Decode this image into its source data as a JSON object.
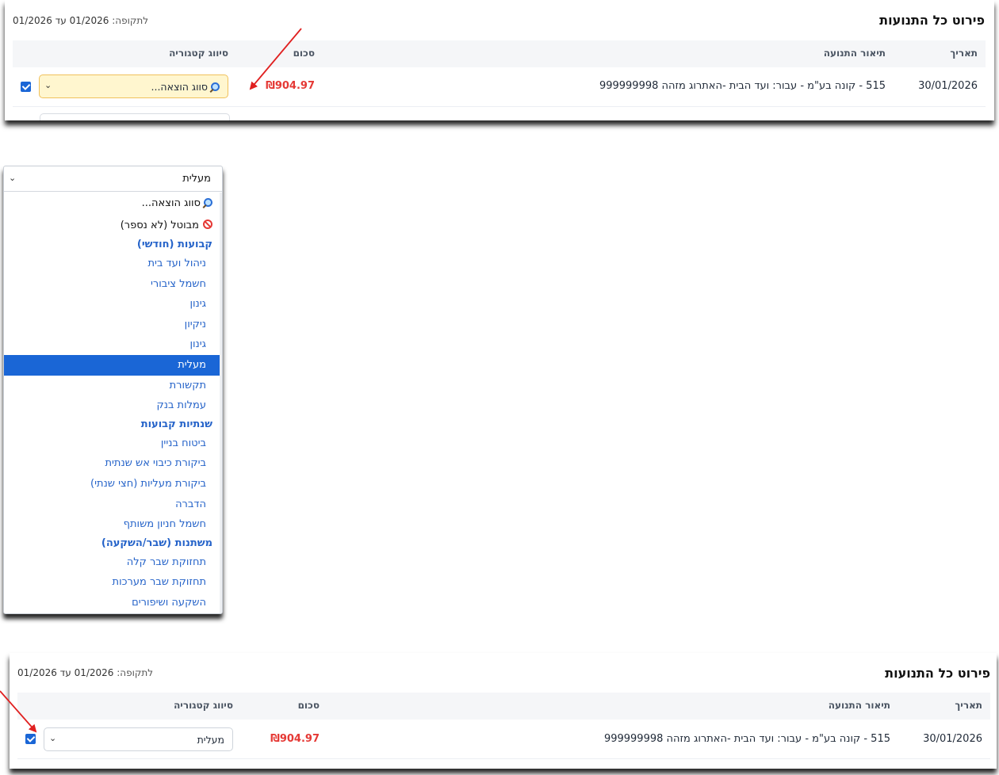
{
  "top_panel": {
    "title": "פירוט כל התנועות",
    "period_label": "לתקופה:",
    "period_range": "01/2026 עד 01/2026",
    "columns": {
      "date": "תאריך",
      "description": "תיאור התנועה",
      "amount": "סכום",
      "category": "סיווג קטגוריה"
    },
    "row": {
      "date": "30/01/2026",
      "description": "515 - קונה בע\"מ - עבור: ועד הבית -האתרוג מזהה 999999998",
      "amount": "₪904.97",
      "category_value": "סווג הוצאה...",
      "checked": true
    }
  },
  "dropdown": {
    "current_value": "מעלית",
    "options": [
      {
        "label": "סווג הוצאה...",
        "kind": "special",
        "icon": "search-icon"
      },
      {
        "label": "מבוטל (לא נספר)",
        "kind": "special",
        "icon": "no-entry-icon"
      },
      {
        "label": "קבועות (חודשי)",
        "kind": "group"
      },
      {
        "label": "ניהול ועד בית",
        "kind": "option"
      },
      {
        "label": "חשמל ציבורי",
        "kind": "option"
      },
      {
        "label": "גינון",
        "kind": "option"
      },
      {
        "label": "ניקיון",
        "kind": "option"
      },
      {
        "label": "גינון",
        "kind": "option"
      },
      {
        "label": "מעלית",
        "kind": "option",
        "selected": true
      },
      {
        "label": "תקשורת",
        "kind": "option"
      },
      {
        "label": "עמלות בנק",
        "kind": "option"
      },
      {
        "label": "שנתיות קבועות",
        "kind": "group"
      },
      {
        "label": "ביטוח בניין",
        "kind": "option"
      },
      {
        "label": "ביקורת כיבוי אש שנתית",
        "kind": "option"
      },
      {
        "label": "ביקורת מעליות (חצי שנתי)",
        "kind": "option"
      },
      {
        "label": "הדברה",
        "kind": "option"
      },
      {
        "label": "חשמל חניון משותף",
        "kind": "option"
      },
      {
        "label": "משתנות (שבר/השקעה)",
        "kind": "group"
      },
      {
        "label": "תחזוקת שבר קלה",
        "kind": "option"
      },
      {
        "label": "תחזוקת שבר מערכות",
        "kind": "option"
      },
      {
        "label": "השקעה ושיפורים",
        "kind": "option"
      }
    ]
  },
  "bottom_panel": {
    "title": "פירוט כל התנועות",
    "period_label": "לתקופה:",
    "period_range": "01/2026 עד 01/2026",
    "columns": {
      "date": "תאריך",
      "description": "תיאור התנועה",
      "amount": "סכום",
      "category": "סיווג קטגוריה"
    },
    "row": {
      "date": "30/01/2026",
      "description": "515 - קונה בע\"מ - עבור: ועד הבית -האתרוג מזהה 999999998",
      "amount": "₪904.97",
      "category_value": "מעלית",
      "checked": true
    }
  },
  "colors": {
    "accent": "#1a66d6",
    "amount": "#e53935",
    "link_option": "#2563c9",
    "highlight_select": "#fff6cf",
    "annotation_arrow": "#e02020"
  }
}
